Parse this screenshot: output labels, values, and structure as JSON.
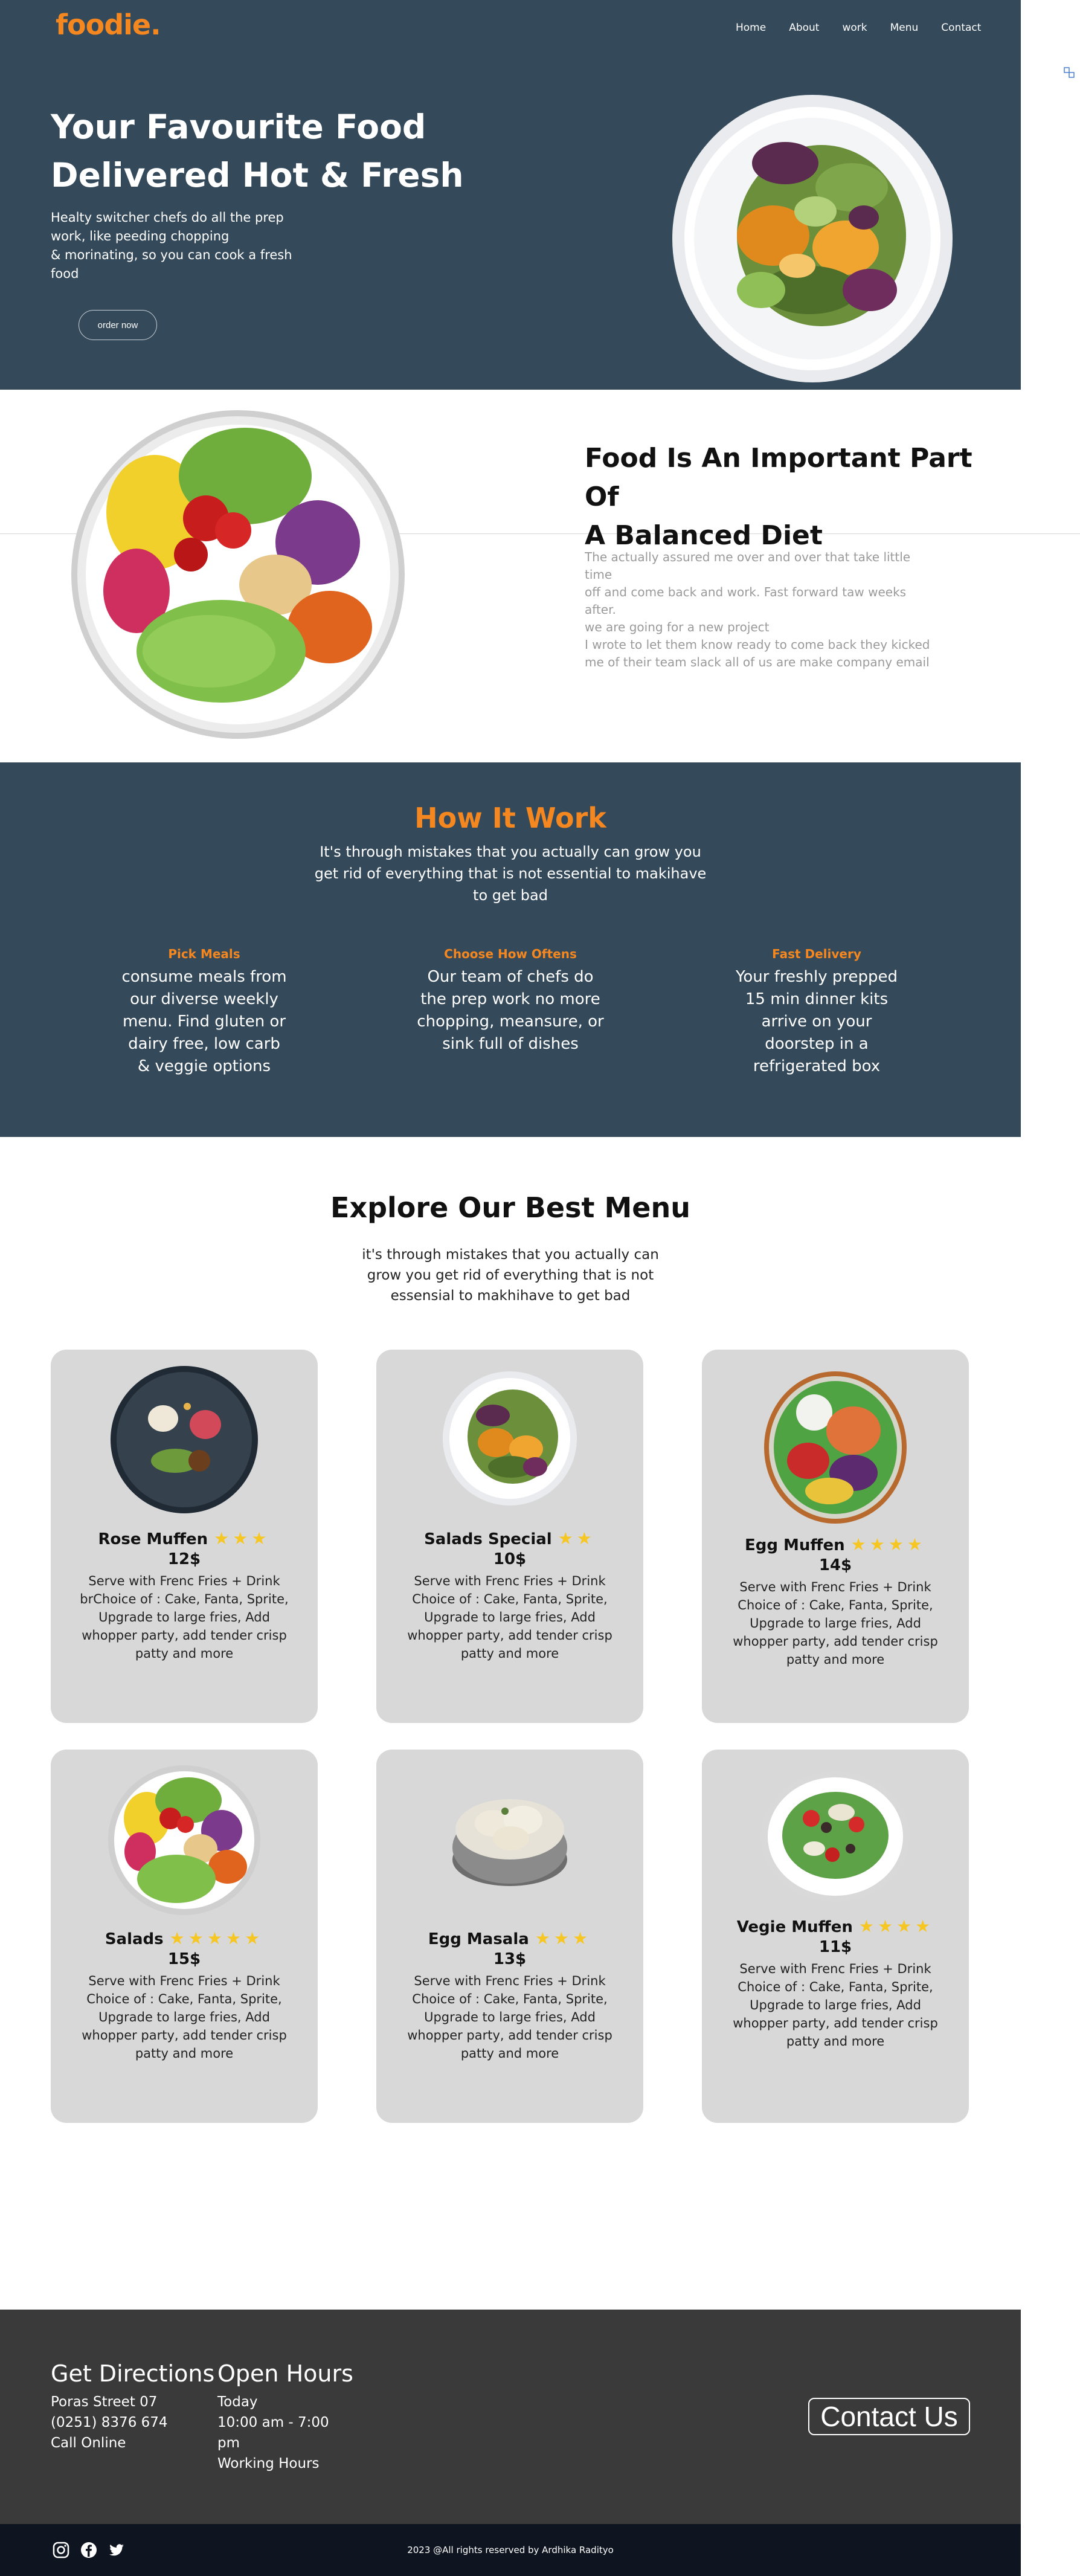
{
  "brand": {
    "logo": "foodie.",
    "accent": "#f4871f",
    "dark": "#34495a"
  },
  "nav": {
    "items": [
      "Home",
      "About",
      "work",
      "Menu",
      "Contact"
    ]
  },
  "hero": {
    "title_line1": "Your Favourite Food",
    "title_line2": "Delivered Hot & Fresh",
    "desc_line1": "Healty switcher chefs do all the prep",
    "desc_line2": "work, like peeding chopping",
    "desc_line3": "& morinating, so you can cook a fresh",
    "desc_line4": "food",
    "button": "order now"
  },
  "diet": {
    "title_line1": "Food Is An Important Part Of",
    "title_line2": "A Balanced Diet",
    "text_line1": "The actually assured me over and over that take little time",
    "text_line2": "off and come back and work. Fast forward taw weeks after.",
    "text_line3": "we are going for a new project",
    "text_line4": "I wrote to let them know ready to come back they kicked",
    "text_line5": "me of their team slack all of us are make company email"
  },
  "how": {
    "title": "How It Work",
    "subtitle": "It's through mistakes that you actually can grow you get rid of everything that is not essential to makihave to get bad",
    "steps": [
      {
        "title": "Pick Meals",
        "desc": "consume meals from our diverse weekly menu. Find gluten or dairy free, low carb & veggie options"
      },
      {
        "title": "Choose How Oftens",
        "desc": "Our team of chefs do the prep work no more chopping, meansure, or sink full of dishes"
      },
      {
        "title": "Fast Delivery",
        "desc": "Your freshly prepped 15 min dinner kits arrive on your doorstep in a refrigerated box"
      }
    ]
  },
  "menu": {
    "title": "Explore Our Best Menu",
    "subtitle": "it's through mistakes that you actually can grow you get rid of everything that is not essensial to makhihave to get bad",
    "cards": [
      {
        "name": "Rose Muffen",
        "stars": "★★★",
        "rating": 3,
        "price": "12$",
        "desc": "Serve with Frenc Fries + Drink brChoice of : Cake, Fanta, Sprite, Upgrade to large fries, Add whopper party, add tender crisp patty and more"
      },
      {
        "name": "Salads Special",
        "stars": "★★",
        "rating": 2,
        "price": "10$",
        "desc": "Serve with Frenc Fries + Drink Choice of : Cake, Fanta, Sprite, Upgrade to large fries, Add whopper party, add tender crisp patty and more"
      },
      {
        "name": "Egg Muffen",
        "stars": "★★★★",
        "rating": 4,
        "price": "14$",
        "desc": "Serve with Frenc Fries + Drink Choice of : Cake, Fanta, Sprite, Upgrade to large fries, Add whopper party, add tender crisp patty and more"
      },
      {
        "name": "Salads",
        "stars": "★★★★★",
        "rating": 5,
        "price": "15$",
        "desc": "Serve with Frenc Fries + Drink Choice of : Cake, Fanta, Sprite, Upgrade to large fries, Add whopper party, add tender crisp patty and more"
      },
      {
        "name": "Egg Masala",
        "stars": "★★★",
        "rating": 3,
        "price": "13$",
        "desc": "Serve with Frenc Fries + Drink Choice of : Cake, Fanta, Sprite, Upgrade to large fries, Add whopper party, add tender crisp patty and more"
      },
      {
        "name": "Vegie Muffen",
        "stars": "★★★★",
        "rating": 4,
        "price": "11$",
        "desc": "Serve with Frenc Fries + Drink Choice of : Cake, Fanta, Sprite, Upgrade to large fries, Add whopper party, add tender crisp patty and more"
      }
    ]
  },
  "footer": {
    "directions": {
      "title": "Get Directions",
      "line1": "Poras Street 07",
      "line2": "(0251) 8376 674",
      "line3": "Call Online"
    },
    "hours": {
      "title": "Open Hours",
      "line1": "Today",
      "line2": "10:00 am - 7:00",
      "line3": "pm",
      "line4": "Working Hours"
    },
    "contact_button": "Contact Us",
    "copyright": "2023 @All rights reserved by Ardhika Radityo",
    "socials": [
      "instagram-icon",
      "facebook-icon",
      "twitter-icon"
    ]
  }
}
